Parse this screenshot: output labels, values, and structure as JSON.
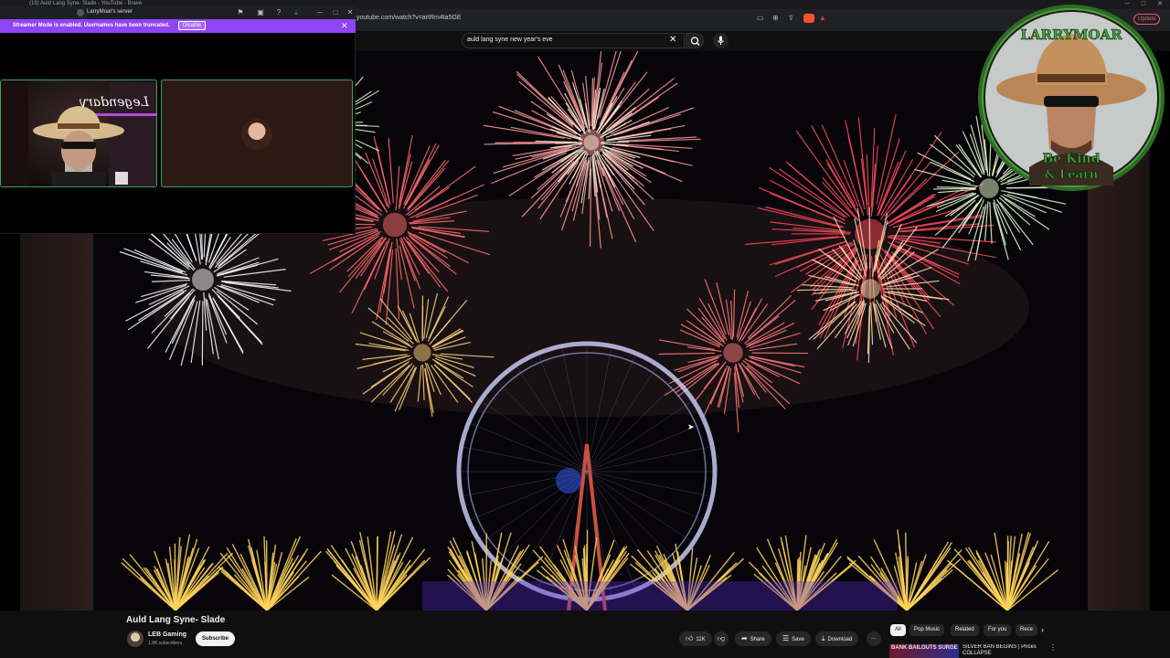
{
  "browser": {
    "tab_title": "(19) Auld Lang Syne- Slade - YouTube - Brave",
    "url": "youtube.com/watch?v=artRm4ta5GE",
    "update_label": "Update",
    "brave_color": "#fb542b"
  },
  "search": {
    "query": "auld lang syne new year's eve",
    "clear_icon": "close-icon",
    "search_icon": "search-icon",
    "mic_icon": "mic-icon"
  },
  "discord": {
    "server_name": "LarryMoar's server",
    "banner_text": "Streamer Mode is enabled. Usernames have been truncated.",
    "disable_label": "Disable",
    "accent": "#8f44f5",
    "speaking_color": "#3ba55d",
    "cam_sign": "Legendary"
  },
  "logo": {
    "top_text": "LARRYMOAR",
    "bottom_text_1": "Be Kind",
    "bottom_text_2": "& Learn",
    "ring_color": "#3c8f2e"
  },
  "video": {
    "title": "Auld Lang Syne- Slade",
    "channel": "LEB Gaming",
    "subscribers": "1.9K subscribers",
    "subscribe_label": "Subscribe",
    "likes": "11K",
    "share_label": "Share",
    "save_label": "Save",
    "download_label": "Download",
    "more_label": "···"
  },
  "chips": [
    "All",
    "Pop Music",
    "Related",
    "For you",
    "Rece"
  ],
  "recommendation": {
    "thumb_text": "BANK BAILOUTS SURGE",
    "title": "SILVER BAN BEGINS | Prices COLLAPSE"
  }
}
